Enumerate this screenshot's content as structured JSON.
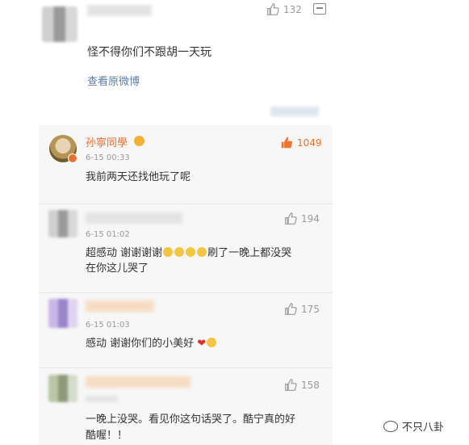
{
  "top_comment": {
    "likes": "132",
    "text": "怪不得你们不跟胡一天玩",
    "view_link": "查看原微博"
  },
  "comments": [
    {
      "user": "孙寧同學",
      "time": "6-15 00:33",
      "likes": "1049",
      "text": "我前两天还找他玩了呢"
    },
    {
      "time": "6-15 01:02",
      "likes": "194",
      "text_line1": "超感动 谢谢谢谢",
      "text_line1_tail": "刷了一晚上都没哭",
      "text_line2": "在你这儿哭了"
    },
    {
      "time": "6-15 01:03",
      "likes": "175",
      "text": "感动 谢谢你们的小美好"
    },
    {
      "likes": "158",
      "text_line1": "一晚上没哭。看见你这句话哭了。酷宁真的好",
      "text_line2": "酷喔！！"
    }
  ],
  "watermark": "不只八卦",
  "colors": {
    "accent": "#e86e2c",
    "link": "#5c7ea8",
    "like_orange": "#f0742f"
  }
}
